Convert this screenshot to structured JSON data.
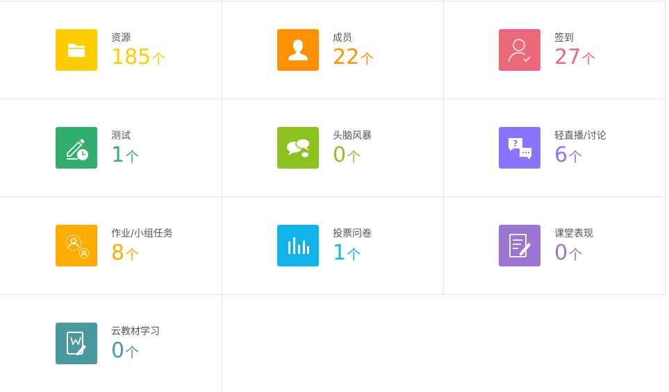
{
  "cards": [
    {
      "key": "resources",
      "label": "资源",
      "count": "185",
      "unit": "个",
      "color": "#ffcc00",
      "icon": "folder-icon"
    },
    {
      "key": "members",
      "label": "成员",
      "count": "22",
      "unit": "个",
      "color": "#ff9000",
      "icon": "member-icon"
    },
    {
      "key": "checkin",
      "label": "签到",
      "count": "27",
      "unit": "个",
      "color": "#ea6a7a",
      "icon": "checkin-icon"
    },
    {
      "key": "test",
      "label": "测试",
      "count": "1",
      "unit": "个",
      "color": "#32ae6e",
      "icon": "test-icon"
    },
    {
      "key": "brainstorm",
      "label": "头脑风暴",
      "count": "0",
      "unit": "个",
      "color": "#8cc21f",
      "icon": "brainstorm-icon"
    },
    {
      "key": "live",
      "label": "轻直播/讨论",
      "count": "6",
      "unit": "个",
      "color": "#8c73ff",
      "icon": "discussion-icon"
    },
    {
      "key": "homework",
      "label": "作业/小组任务",
      "count": "8",
      "unit": "个",
      "color": "#ffac00",
      "icon": "group-task-icon"
    },
    {
      "key": "vote",
      "label": "投票问卷",
      "count": "1",
      "unit": "个",
      "color": "#11b3ea",
      "icon": "bar-chart-icon"
    },
    {
      "key": "performance",
      "label": "课堂表现",
      "count": "0",
      "unit": "个",
      "color": "#9a75d2",
      "icon": "note-edit-icon"
    },
    {
      "key": "ebook",
      "label": "云教材学习",
      "count": "0",
      "unit": "个",
      "color": "#4a999e",
      "icon": "ebook-icon"
    }
  ]
}
